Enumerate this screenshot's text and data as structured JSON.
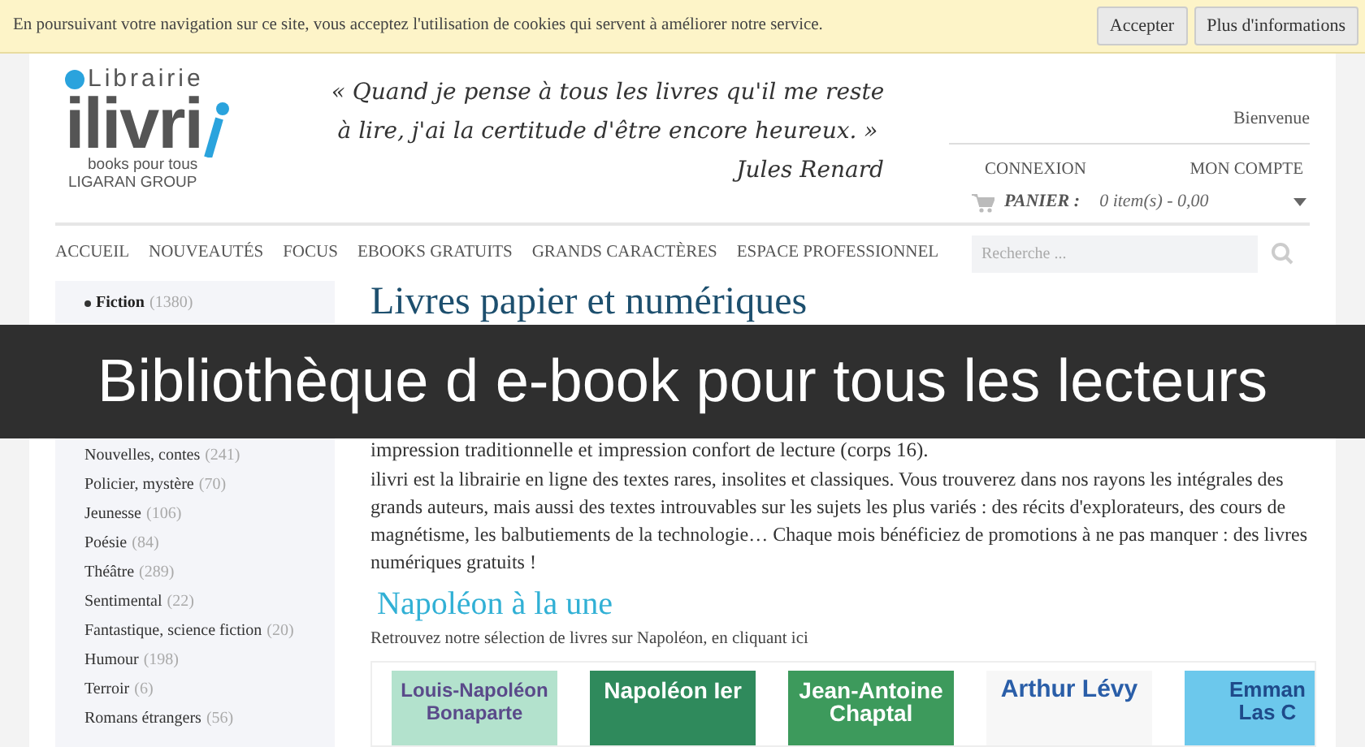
{
  "cookie_bar": {
    "text": "En poursuivant votre navigation sur ce site, vous acceptez l'utilisation de cookies qui servent à améliorer notre service.",
    "buttons": [
      "Accepter",
      "Plus d'informations"
    ]
  },
  "header": {
    "logo": {
      "name": "Librairie",
      "brand": "ilivri",
      "tagline": "books pour tous",
      "group": "LIGARAN GROUP"
    },
    "quote": {
      "lines": [
        "« Quand je pense à tous les livres qu'il me reste",
        "à lire, j'ai la certitude d'être encore heureux. »"
      ],
      "author": "Jules Renard"
    },
    "account": {
      "welcome": "Bienvenue",
      "links": [
        "CONNEXION",
        "MON COMPTE"
      ],
      "cart_label": "PANIER :",
      "cart_value": "0 item(s) - 0,00"
    }
  },
  "nav": {
    "items": [
      "ACCUEIL",
      "NOUVEAUTÉS",
      "FOCUS",
      "EBOOKS GRATUITS",
      "GRANDS CARACTÈRES",
      "ESPACE PROFESSIONNEL"
    ],
    "search_placeholder": "Recherche ..."
  },
  "banner": "Bibliothèque d e-book pour tous les lecteurs",
  "sidebar": {
    "categories": [
      {
        "name": "Fiction",
        "count": "(1380)",
        "children": [
          {
            "name": "Nouvelles, contes",
            "count": "(241)"
          },
          {
            "name": "Policier, mystère",
            "count": "(70)"
          },
          {
            "name": "Jeunesse",
            "count": "(106)"
          },
          {
            "name": "Poésie",
            "count": "(84)"
          },
          {
            "name": "Théâtre",
            "count": "(289)"
          },
          {
            "name": "Sentimental",
            "count": "(22)"
          },
          {
            "name": "Fantastique, science fiction",
            "count": "(20)"
          },
          {
            "name": "Humour",
            "count": "(198)"
          },
          {
            "name": "Terroir",
            "count": "(6)"
          },
          {
            "name": "Romans étrangers",
            "count": "(56)"
          }
        ]
      }
    ]
  },
  "main": {
    "title": "Livres papier et numériques",
    "intro_line": "impression traditionnelle et impression confort de lecture (corps 16).",
    "paragraph": "ilivri est la librairie en ligne des textes rares, insolites et classiques. Vous trouverez dans nos rayons les intégrales des grands auteurs, mais aussi des textes introuvables sur les sujets les plus variés : des récits d'explorateurs, des cours de magnétisme, les balbutiements de la technologie… Chaque mois bénéficiez de promotions à ne pas manquer : des livres numériques gratuits !",
    "section": {
      "title": "Napoléon à la une",
      "subtitle": "Retrouvez notre sélection de livres sur Napoléon, en cliquant ici",
      "books": [
        {
          "lines": [
            "Louis-Napoléon",
            "Bonaparte"
          ],
          "color": "#b3e2cd"
        },
        {
          "lines": [
            "Napoléon Ier"
          ],
          "color": "#2f8a5c"
        },
        {
          "lines": [
            "Jean-Antoine",
            "Chaptal"
          ],
          "color": "#3d9a5c"
        },
        {
          "lines": [
            "Arthur Lévy"
          ],
          "color": "#f7f7f7"
        },
        {
          "lines": [
            "Emman",
            "Las C"
          ],
          "color": "#6cc8ec"
        }
      ]
    }
  }
}
